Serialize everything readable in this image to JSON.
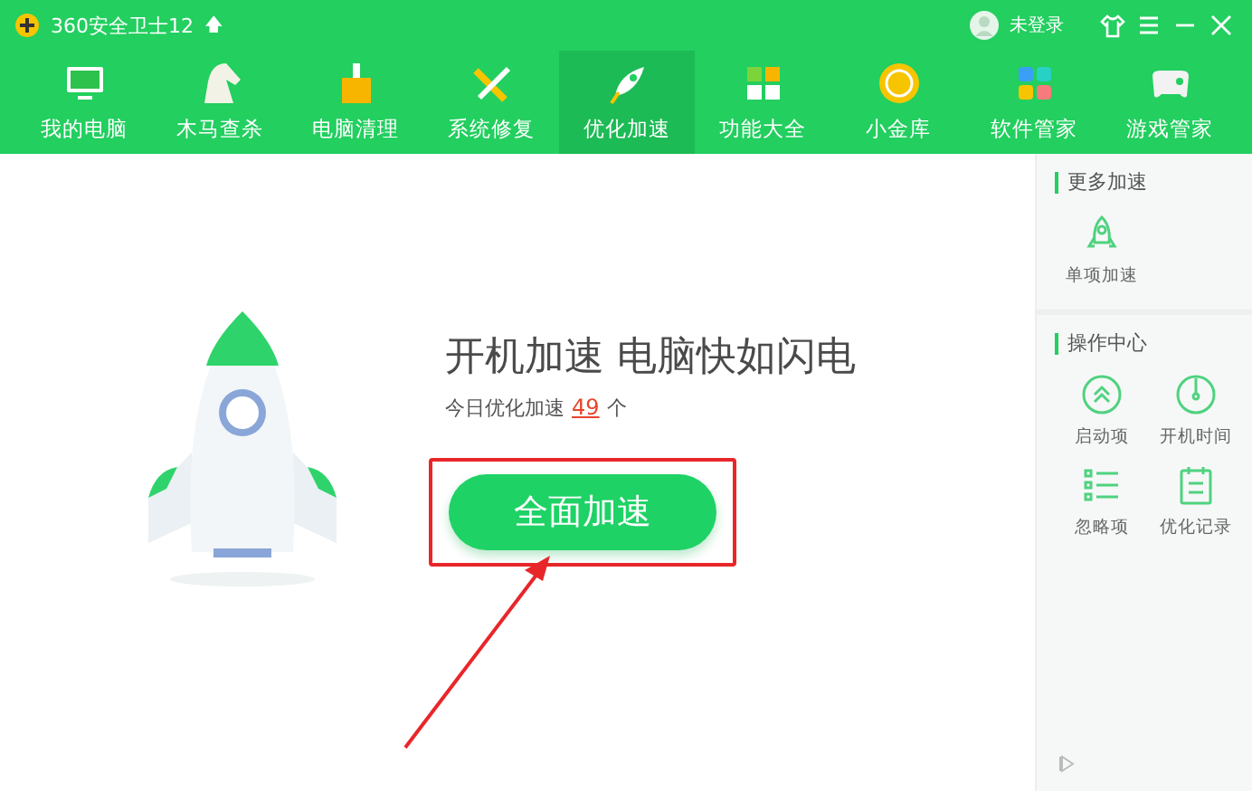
{
  "window": {
    "title": "360安全卫士12",
    "upgrade": "🡅",
    "user": "未登录"
  },
  "tabs": [
    {
      "label": "我的电脑",
      "selected": false
    },
    {
      "label": "木马查杀",
      "selected": false
    },
    {
      "label": "电脑清理",
      "selected": false
    },
    {
      "label": "系统修复",
      "selected": false
    },
    {
      "label": "优化加速",
      "selected": true
    },
    {
      "label": "功能大全",
      "selected": false
    },
    {
      "label": "小金库",
      "selected": false
    },
    {
      "label": "软件管家",
      "selected": false
    },
    {
      "label": "游戏管家",
      "selected": false
    }
  ],
  "main": {
    "headline": "开机加速 电脑快如闪电",
    "counter_prefix": "今日优化加速",
    "count": "49",
    "counter_suffix": "个",
    "button": "全面加速"
  },
  "sidebar": {
    "sections": [
      {
        "title": "更多加速",
        "items": [
          "单项加速"
        ]
      },
      {
        "title": "操作中心",
        "items": [
          "启动项",
          "开机时间",
          "忽略项",
          "优化记录"
        ]
      }
    ]
  }
}
